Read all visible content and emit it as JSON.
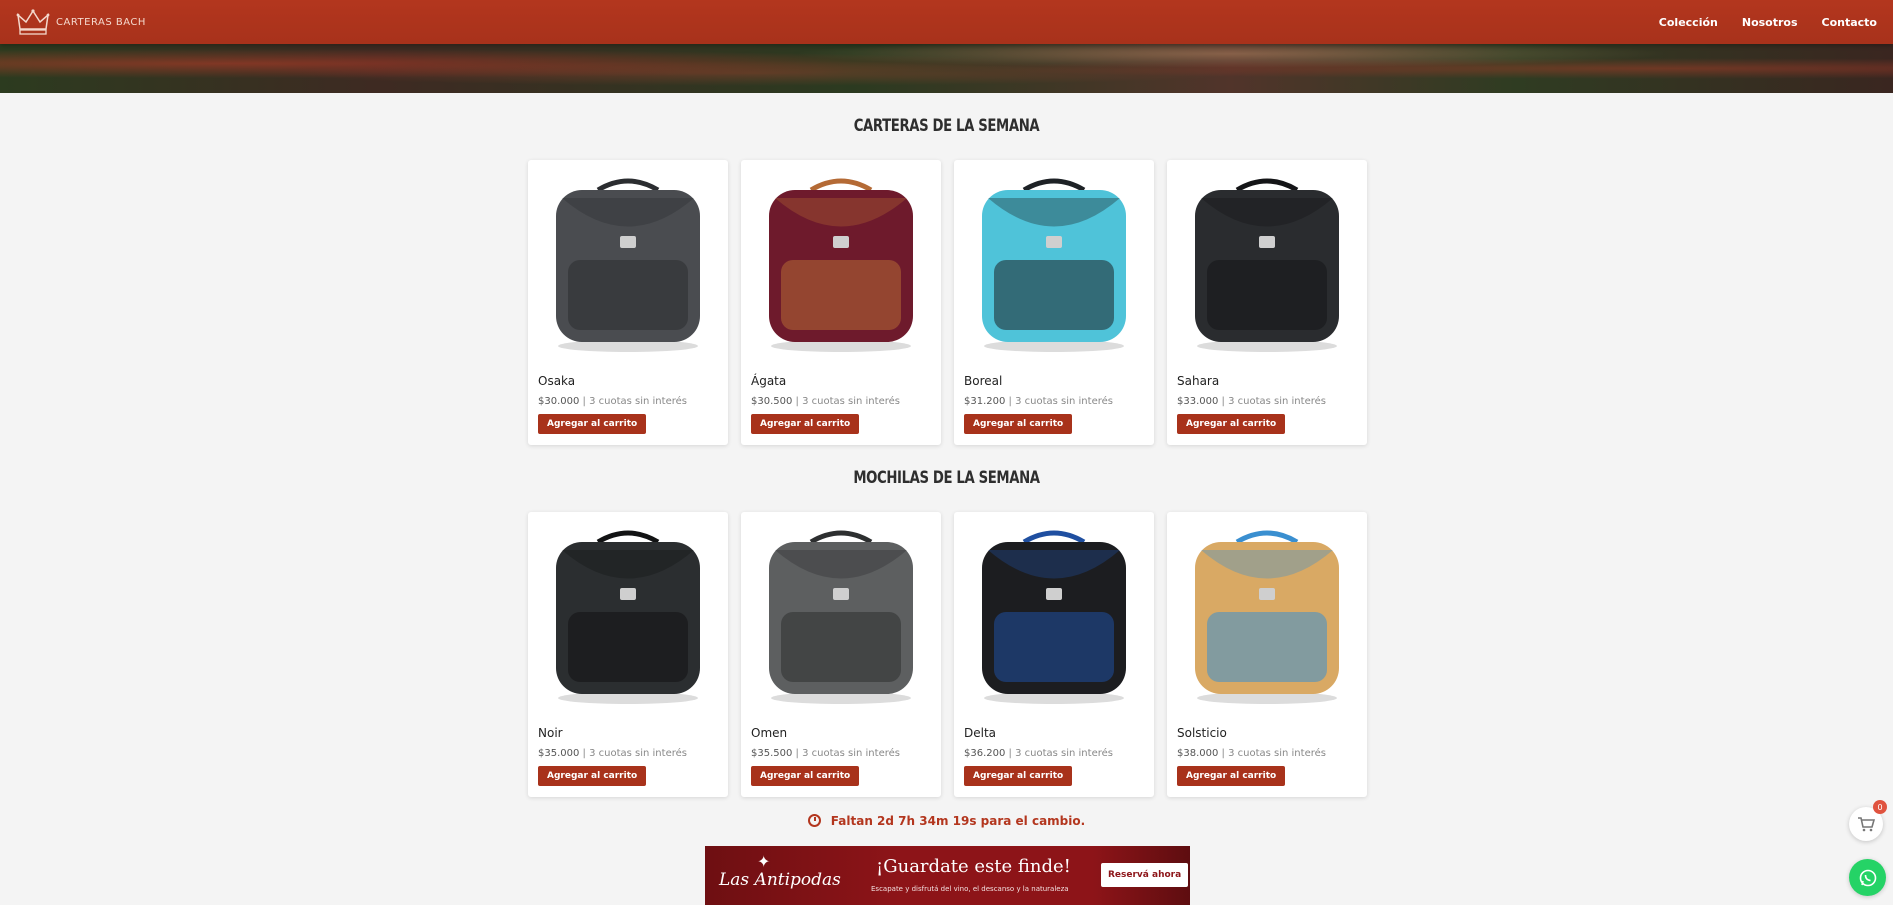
{
  "header": {
    "brand_name": "CARTERAS BACH",
    "nav": [
      "Colección",
      "Nosotros",
      "Contacto"
    ]
  },
  "sections": [
    {
      "title": "CARTERAS DE LA SEMANA",
      "products": [
        {
          "name": "Osaka",
          "price": "$30.000",
          "installments": "3 cuotas sin interés",
          "button": "Agregar al carrito",
          "colors": [
            "#4a4c50",
            "#2b2d30"
          ]
        },
        {
          "name": "Ágata",
          "price": "$30.500",
          "installments": "3 cuotas sin interés",
          "button": "Agregar al carrito",
          "colors": [
            "#6e1a2c",
            "#b46a35"
          ]
        },
        {
          "name": "Boreal",
          "price": "$31.200",
          "installments": "3 cuotas sin interés",
          "button": "Agregar al carrito",
          "colors": [
            "#4fc3d9",
            "#1e2226"
          ]
        },
        {
          "name": "Sahara",
          "price": "$33.000",
          "installments": "3 cuotas sin interés",
          "button": "Agregar al carrito",
          "colors": [
            "#2a2c2f",
            "#141517"
          ]
        }
      ]
    },
    {
      "title": "MOCHILAS DE LA SEMANA",
      "products": [
        {
          "name": "Noir",
          "price": "$35.000",
          "installments": "3 cuotas sin interés",
          "button": "Agregar al carrito",
          "colors": [
            "#2b2e30",
            "#121314"
          ]
        },
        {
          "name": "Omen",
          "price": "$35.500",
          "installments": "3 cuotas sin interés",
          "button": "Agregar al carrito",
          "colors": [
            "#5d5f60",
            "#2d2f30"
          ]
        },
        {
          "name": "Delta",
          "price": "$36.200",
          "installments": "3 cuotas sin interés",
          "button": "Agregar al carrito",
          "colors": [
            "#1c1d20",
            "#1f4fa0"
          ]
        },
        {
          "name": "Solsticio",
          "price": "$38.000",
          "installments": "3 cuotas sin interés",
          "button": "Agregar al carrito",
          "colors": [
            "#d9a964",
            "#3a8fd0"
          ]
        }
      ]
    }
  ],
  "countdown": {
    "text": "Faltan 2d 7h 34m 19s para el cambio."
  },
  "promo": {
    "logo": "Las Antipodas",
    "title": "¡Guardate este finde!",
    "subtitle": "Escapate y disfrutá del vino, el descanso y la naturaleza",
    "button": "Reservá ahora"
  },
  "cart": {
    "count": "0"
  },
  "accent_color": "#a8321b"
}
